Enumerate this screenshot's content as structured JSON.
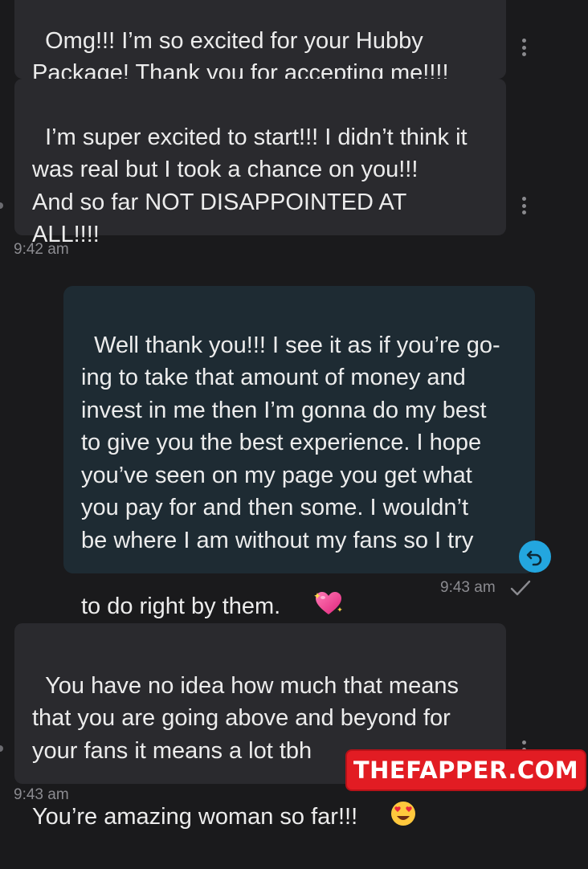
{
  "messages": [
    {
      "direction": "received",
      "text": "Omg!!! I’m so excited for your Hubby\nPackage! Thank you for accepting me!!!!"
    },
    {
      "direction": "received",
      "text": "I’m super excited to start!!! I didn’t think it\nwas real but I took a chance on you!!!\nAnd so far NOT DISAPPOINTED AT\nALL!!!!",
      "timestamp": "9:42 am"
    },
    {
      "direction": "sent",
      "text": "Well thank you!!! I see it as if you’re go-\ning to take that amount of money and\ninvest in me then I’m gonna do my best\nto give you the best experience. I hope\nyou’ve seen on my page you get what\nyou pay for and then some. I wouldn’t\nbe where I am without my fans so I try\nto do right by them. ",
      "emoji": "sparkling-heart",
      "timestamp": "9:43 am",
      "status_icon": "check-icon"
    },
    {
      "direction": "received",
      "text": "You have no idea how much that means\nthat you are going above and beyond for\nyour fans it means a lot tbh\nYou’re amazing woman so far!!! ",
      "emoji": "heart-eyes",
      "timestamp": "9:43 am"
    }
  ],
  "watermark": "THEFAPPER.COM",
  "colors": {
    "background": "#1a1a1c",
    "received_bubble": "#2a2a2e",
    "sent_bubble": "#1e2b33",
    "accent": "#23a6df",
    "watermark": "#e21c23"
  }
}
